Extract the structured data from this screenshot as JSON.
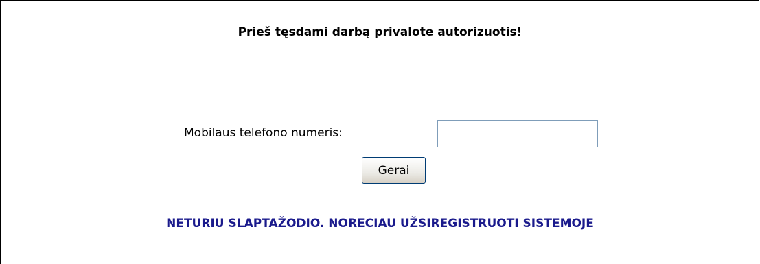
{
  "login": {
    "heading": "Prieš tęsdami darbą privalote autorizuotis!",
    "phone_label": "Mobilaus telefono numeris:",
    "phone_value": "",
    "submit_label": "Gerai",
    "register_link": "NETURIU SLAPTAŽODIO. NORECIAU UŽSIREGISTRUOTI SISTEMOJE"
  },
  "colors": {
    "link": "#1a1a8c",
    "input_border": "#7f9db9",
    "button_border": "#003c74"
  }
}
